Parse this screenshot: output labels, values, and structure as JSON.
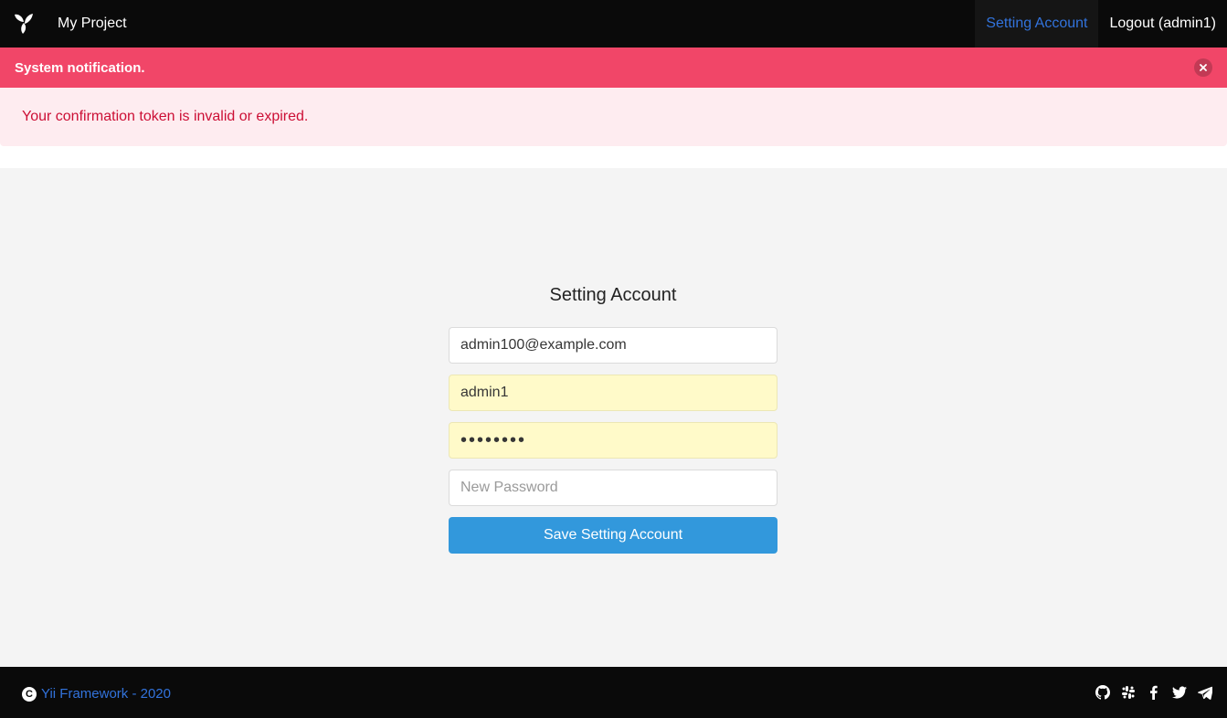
{
  "navbar": {
    "brand": "My Project",
    "logo_icon": "yii-logo-icon",
    "links": [
      {
        "label": "Setting Account",
        "active": true
      },
      {
        "label": "Logout (admin1)",
        "active": false
      }
    ]
  },
  "notification": {
    "title": "System notification.",
    "message": "Your confirmation token is invalid or expired.",
    "close_icon": "close-icon",
    "colors": {
      "header": "#f14668",
      "body_bg": "#feecf0",
      "body_text": "#cc0f35"
    }
  },
  "form": {
    "title": "Setting Account",
    "email_value": "admin100@example.com",
    "username_value": "admin1",
    "password_value": "••••••••",
    "new_password_placeholder": "New Password",
    "submit_label": "Save Setting Account",
    "button_color": "#3298dc"
  },
  "footer": {
    "copyright_icon": "copyright-icon",
    "link_text": "Yii Framework - 2020",
    "social_icons": [
      "github-icon",
      "slack-icon",
      "facebook-icon",
      "twitter-icon",
      "telegram-icon"
    ]
  }
}
